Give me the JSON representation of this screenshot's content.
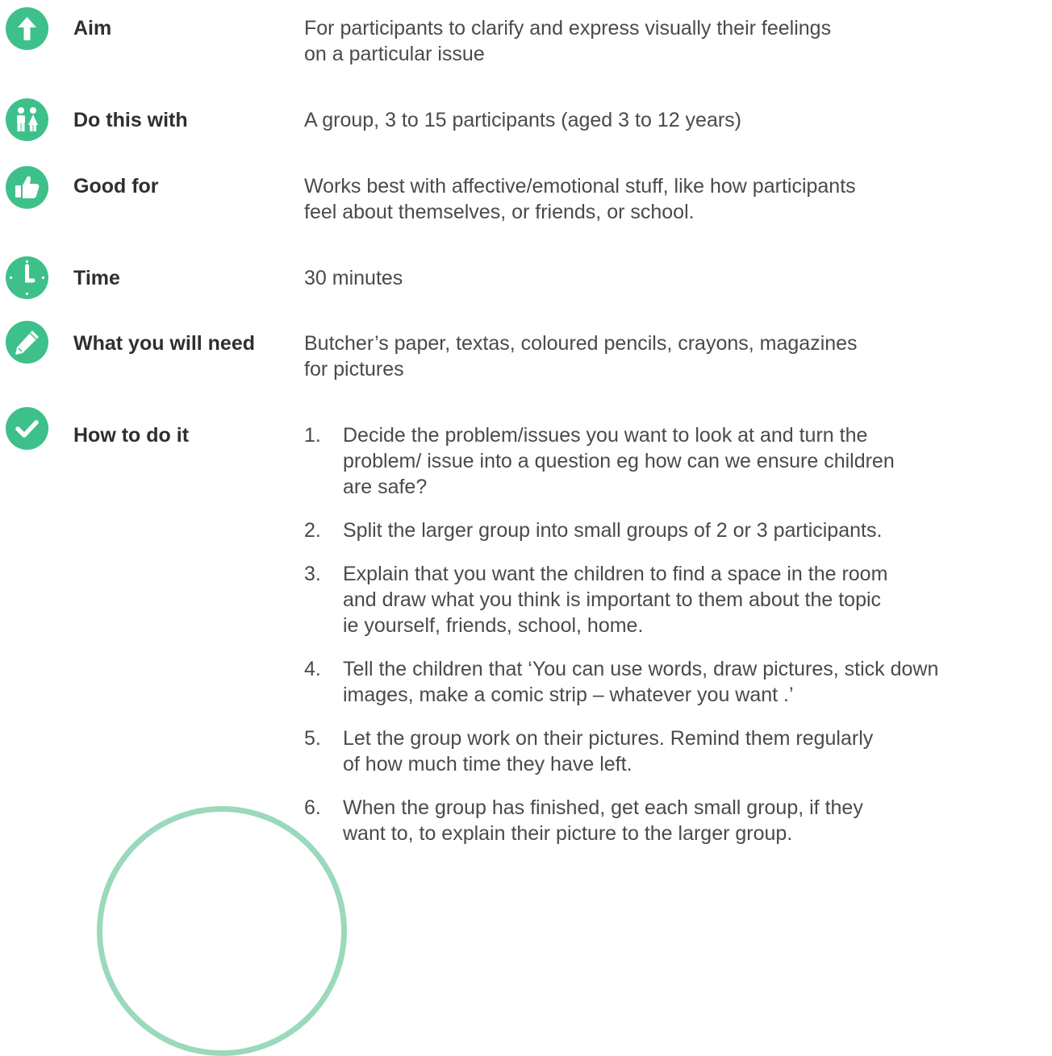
{
  "rows": {
    "aim": {
      "icon": "arrow-up-icon",
      "label": "Aim",
      "value": "For participants to clarify and express visually their feelings\non a particular issue"
    },
    "do_with": {
      "icon": "children-icon",
      "label": "Do this with",
      "value": "A group, 3 to 15 participants (aged 3 to 12 years)"
    },
    "good_for": {
      "icon": "thumbs-up-icon",
      "label": "Good for",
      "value": "Works best with affective/emotional stuff, like how participants\nfeel about themselves, or friends, or school."
    },
    "time": {
      "icon": "clock-icon",
      "label": "Time",
      "value": "30 minutes"
    },
    "need": {
      "icon": "pencil-icon",
      "label": "What you will need",
      "value": "Butcher’s paper, textas, coloured pencils, crayons, magazines\nfor pictures"
    },
    "how": {
      "icon": "checkmark-icon",
      "label": "How to do it"
    }
  },
  "steps": [
    {
      "num": "1.",
      "text": "Decide the problem/issues you want to look at and turn the\nproblem/ issue into a question eg how can we ensure children\nare safe?"
    },
    {
      "num": "2.",
      "text": "Split the larger group into small groups of 2 or 3 participants."
    },
    {
      "num": "3.",
      "text": "Explain that you want the children to find a space in the room\nand draw what you think is important to them about the topic\nie yourself, friends, school, home."
    },
    {
      "num": "4.",
      "text": "Tell the children that ‘You can use words, draw pictures, stick down\nimages, make a comic strip – whatever you want .’"
    },
    {
      "num": "5.",
      "text": "Let the group work on their pictures. Remind them regularly\nof how much time they have left."
    },
    {
      "num": "6.",
      "text": "When the group has finished, get each small group, if they\nwant to, to explain their picture to the larger group."
    }
  ],
  "colors": {
    "accent": "#3ec08a",
    "decor_ring": "#9ad9bb",
    "text": "#4a4a4a",
    "label": "#2f2f2f"
  }
}
